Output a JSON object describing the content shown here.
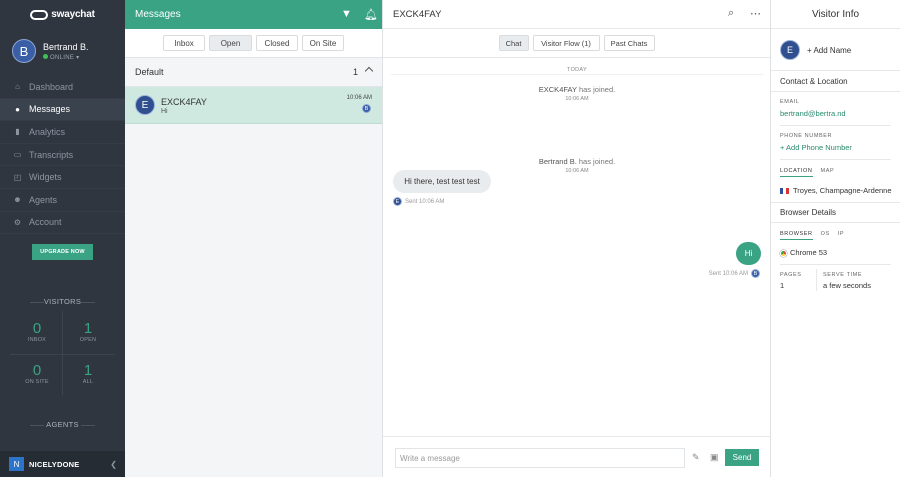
{
  "brand": {
    "logo_text": "swaychat"
  },
  "profile": {
    "initial": "B",
    "name": "Bertrand B.",
    "status": "ONLINE"
  },
  "nav": [
    {
      "label": "Dashboard",
      "icon": "home-icon"
    },
    {
      "label": "Messages",
      "icon": "chat-bubble-icon",
      "active": true
    },
    {
      "label": "Analytics",
      "icon": "bar-chart-icon"
    },
    {
      "label": "Transcripts",
      "icon": "folder-icon"
    },
    {
      "label": "Widgets",
      "icon": "widget-icon"
    },
    {
      "label": "Agents",
      "icon": "users-icon"
    },
    {
      "label": "Account",
      "icon": "gear-icon"
    }
  ],
  "upgrade_label": "UPGRADE NOW",
  "visitors": {
    "title": "VISITORS",
    "inbox": {
      "value": "0",
      "label": "INBOX"
    },
    "open": {
      "value": "1",
      "label": "OPEN"
    },
    "on_site": {
      "value": "0",
      "label": "ON SITE"
    },
    "all": {
      "value": "1",
      "label": "ALL"
    }
  },
  "agents_title": "AGENTS",
  "org": {
    "initial": "N",
    "name": "NICELYDONE"
  },
  "list": {
    "title": "Messages",
    "filters": [
      "Inbox",
      "Open",
      "Closed",
      "On Site"
    ],
    "active_filter": "Open",
    "group": {
      "name": "Default",
      "count": "1"
    },
    "conversation": {
      "initial": "E",
      "name": "EXCK4FAY",
      "preview": "Hi",
      "time": "10:06 AM",
      "agent_initial": "B"
    }
  },
  "chat": {
    "title": "EXCK4FAY",
    "tabs": [
      "Chat",
      "Visitor Flow (1)",
      "Past Chats"
    ],
    "active_tab": "Chat",
    "day_label": "TODAY",
    "events": [
      {
        "who": "EXCK4FAY",
        "text": "has joined.",
        "time": "10:06 AM"
      },
      {
        "who": "Bertrand B.",
        "text": "has joined.",
        "time": "10:06 AM"
      }
    ],
    "incoming": {
      "text": "Hi there, test test test",
      "sent": "Sent 10:06 AM",
      "initial": "E"
    },
    "outgoing": {
      "text": "Hi",
      "sent": "Sent 10:06 AM",
      "initial": "B"
    },
    "composer": {
      "placeholder": "Write a message",
      "send_label": "Send"
    }
  },
  "info": {
    "title": "Visitor Info",
    "initial": "E",
    "add_name": "+ Add Name",
    "contact_header": "Contact & Location",
    "email_label": "EMAIL",
    "email": "bertrand@bertra.nd",
    "phone_label": "PHONE NUMBER",
    "add_phone": "+ Add Phone Number",
    "loc_tabs": [
      "LOCATION",
      "MAP"
    ],
    "location": "Troyes, Champagne-Ardenne",
    "browser_header": "Browser Details",
    "browser_tabs": [
      "BROWSER",
      "OS",
      "IP"
    ],
    "browser": "Chrome 53",
    "pages_label": "PAGES",
    "pages": "1",
    "serve_label": "SERVE TIME",
    "serve": "a few seconds"
  },
  "colors": {
    "accent": "#3aa383",
    "sidebar": "#2f3640",
    "selected_row": "#cfe9e0"
  }
}
